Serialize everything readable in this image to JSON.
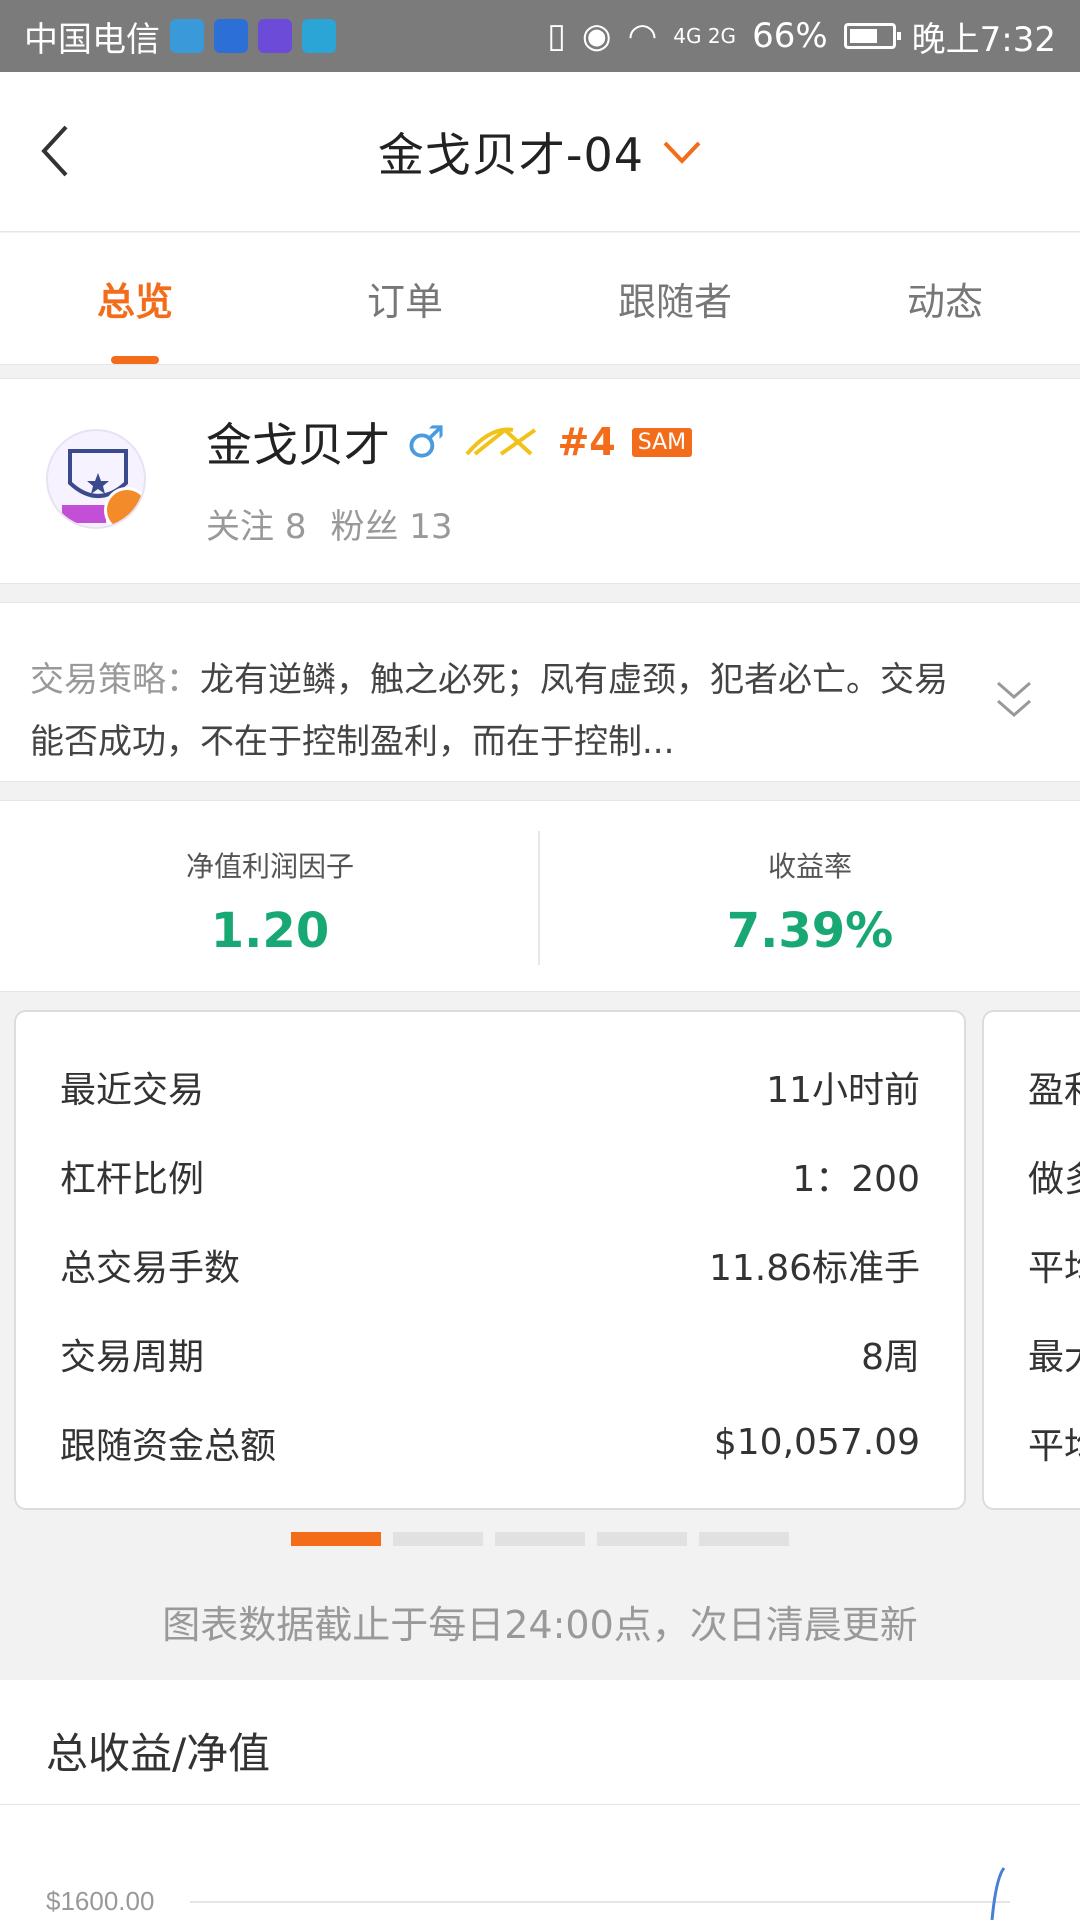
{
  "status_bar": {
    "carrier": "中国电信",
    "network": "4G 2G",
    "battery": "66%",
    "time": "晚上7:32"
  },
  "header": {
    "title": "金戈贝才-04"
  },
  "tabs": [
    {
      "label": "总览",
      "active": true
    },
    {
      "label": "订单",
      "active": false
    },
    {
      "label": "跟随者",
      "active": false
    },
    {
      "label": "动态",
      "active": false
    }
  ],
  "profile": {
    "name": "金戈贝才",
    "gender_symbol": "♂",
    "rank": "#4",
    "badge": "SAM",
    "follow_label": "关注",
    "follow_count": "8",
    "fans_label": "粉丝",
    "fans_count": "13"
  },
  "strategy": {
    "label": "交易策略：",
    "text": "龙有逆鳞，触之必死；凤有虚颈，犯者必亡。交易能否成功，不在于控制盈利，而在于控制..."
  },
  "metrics": [
    {
      "label": "净值利润因子",
      "value": "1.20"
    },
    {
      "label": "收益率",
      "value": "7.39%"
    }
  ],
  "card": {
    "rows": [
      {
        "label": "最近交易",
        "value": "11小时前"
      },
      {
        "label": "杠杆比例",
        "value": "1：200"
      },
      {
        "label": "总交易手数",
        "value": "11.86标准手"
      },
      {
        "label": "交易周期",
        "value": "8周"
      },
      {
        "label": "跟随资金总额",
        "value": "$10,057.09"
      }
    ]
  },
  "peek_card": {
    "rows": [
      "盈利",
      "做多",
      "平均",
      "最大",
      "平均"
    ]
  },
  "pagination": {
    "count": 5,
    "active_index": 0
  },
  "note": "图表数据截止于每日24:00点，次日清晨更新",
  "chart": {
    "title": "总收益/净值",
    "y_tick": "$1600.00"
  },
  "colors": {
    "accent": "#f36c1a",
    "positive": "#18a874"
  }
}
